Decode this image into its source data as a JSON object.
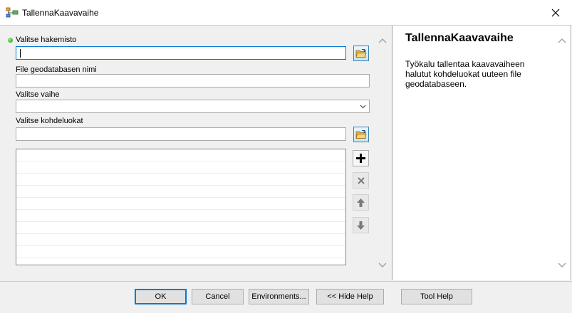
{
  "window": {
    "title": "TallennaKaavavaihe",
    "icon": "model-tool-icon",
    "close_icon": "close-icon"
  },
  "params": {
    "hakemisto": {
      "label": "Valitse hakemisto",
      "value": "",
      "required": true
    },
    "gdb_name": {
      "label": "File geodatabasen nimi",
      "value": ""
    },
    "vaihe": {
      "label": "Valitse vaihe",
      "value": ""
    },
    "kohdeluokat": {
      "label": "Valitse kohdeluokat",
      "value": "",
      "items": []
    }
  },
  "help": {
    "title": "TallennaKaavavaihe",
    "body": "Työkalu tallentaa kaavavaiheen halutut kohdeluokat uuteen file geodatabaseen."
  },
  "buttons": {
    "ok": "OK",
    "cancel": "Cancel",
    "environments": "Environments...",
    "hide_help": "<< Hide Help",
    "tool_help": "Tool Help"
  },
  "colors": {
    "accent": "#0078d7",
    "required_dot": "#1a9a11"
  }
}
